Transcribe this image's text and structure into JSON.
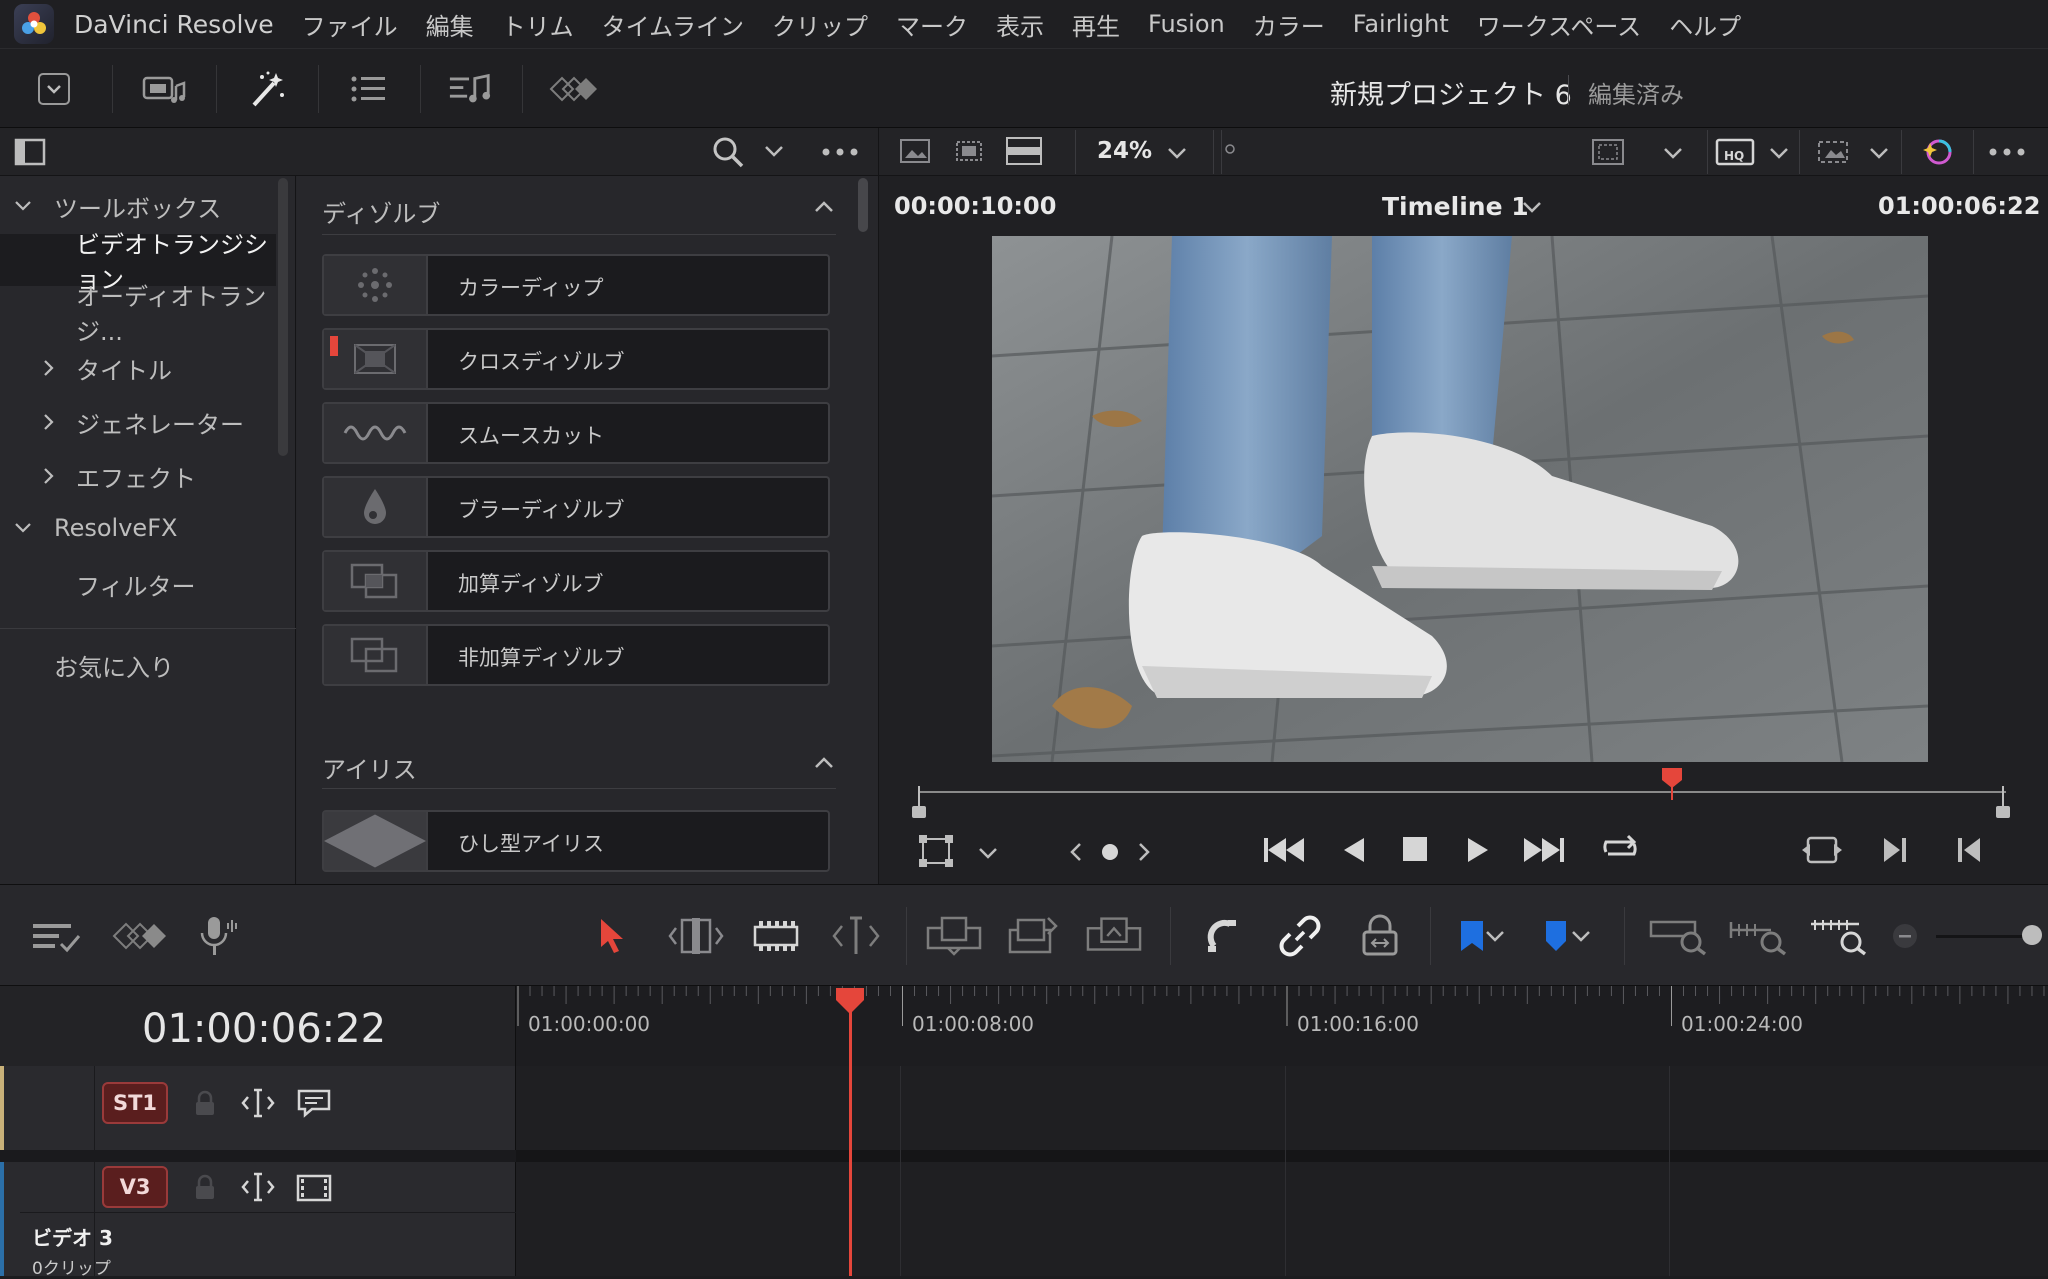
{
  "menubar": {
    "app_name": "DaVinci Resolve",
    "items": [
      "ファイル",
      "編集",
      "トリム",
      "タイムライン",
      "クリップ",
      "マーク",
      "表示",
      "再生",
      "Fusion",
      "カラー",
      "Fairlight",
      "ワークスペース",
      "ヘルプ"
    ]
  },
  "toolbar": {
    "project_title": "新規プロジェクト 6",
    "project_status": "編集済み"
  },
  "tree": {
    "toolbox": "ツールボックス",
    "video_transitions": "ビデオトランジション",
    "audio_transitions": "オーディオトランジ...",
    "titles": "タイトル",
    "generators": "ジェネレーター",
    "effects": "エフェクト",
    "resolvefx": "ResolveFX",
    "filters": "フィルター",
    "favorites": "お気に入り"
  },
  "effects_list": {
    "dissolve_section": "ディゾルブ",
    "dissolve_items": [
      "カラーディップ",
      "クロスディゾルブ",
      "スムースカット",
      "ブラーディゾルブ",
      "加算ディゾルブ",
      "非加算ディゾルブ"
    ],
    "iris_section": "アイリス",
    "iris_items": [
      "ひし型アイリス"
    ]
  },
  "viewer": {
    "zoom": "24%",
    "duration": "00:00:10:00",
    "timeline_name": "Timeline 1",
    "timecode": "01:00:06:22"
  },
  "timeline": {
    "current_timecode": "01:00:06:22",
    "ruler_labels": [
      "01:00:00:00",
      "01:00:08:00",
      "01:00:16:00",
      "01:00:24:00"
    ],
    "tracks": {
      "st1": "ST1",
      "v3": "V3",
      "v3_name": "ビデオ 3",
      "v3_clips": "0クリップ"
    }
  },
  "colors": {
    "accent_red": "#e5463b",
    "marker_blue": "#1e6fe0"
  }
}
